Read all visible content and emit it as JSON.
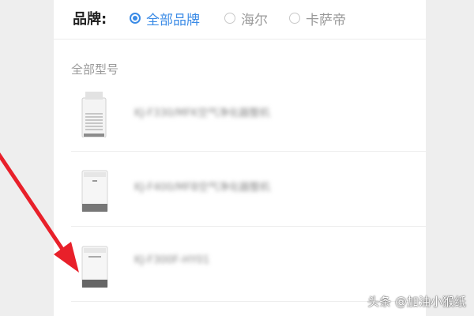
{
  "brand_filter": {
    "label": "品牌:",
    "options": [
      {
        "label": "全部品牌",
        "selected": true
      },
      {
        "label": "海尔",
        "selected": false
      },
      {
        "label": "卡萨帝",
        "selected": false
      }
    ]
  },
  "models_section": {
    "title": "全部型号",
    "products": [
      {
        "name": "KJ-F330/MFK空气净化器整机"
      },
      {
        "name": "KJ-F400/MFB空气净化器整机"
      },
      {
        "name": "KJ-F300F-HY01"
      }
    ]
  },
  "watermark": "头条 @加油小猴纸",
  "colors": {
    "accent": "#3b8be6",
    "arrow": "#e8202a"
  }
}
